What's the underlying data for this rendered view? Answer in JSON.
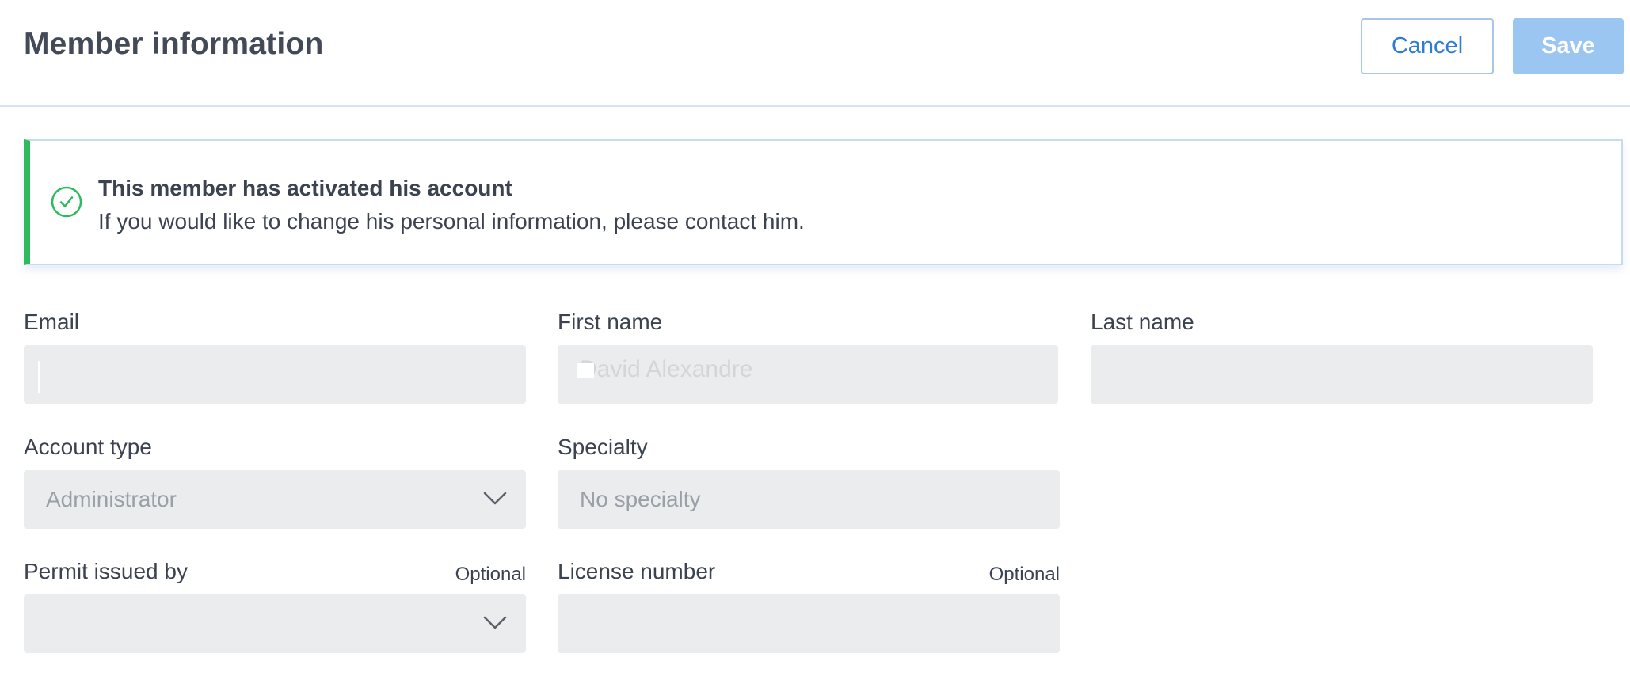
{
  "header": {
    "title": "Member information",
    "cancel_label": "Cancel",
    "save_label": "Save"
  },
  "banner": {
    "icon": "check-circle-icon",
    "title": "This member has activated his account",
    "text": "If you would like to change his personal information, please contact him."
  },
  "form": {
    "email": {
      "label": "Email",
      "value": ""
    },
    "first_name": {
      "label": "First name",
      "value": "David Alexandre"
    },
    "last_name": {
      "label": "Last name",
      "value": ""
    },
    "account_type": {
      "label": "Account type",
      "value": "Administrator"
    },
    "specialty": {
      "label": "Specialty",
      "value": "No specialty"
    },
    "permit_issued_by": {
      "label": "Permit issued by",
      "optional": "Optional",
      "value": ""
    },
    "license_number": {
      "label": "License number",
      "optional": "Optional",
      "value": ""
    }
  },
  "colors": {
    "accent": "#2f7bd6",
    "save_disabled": "#9cc6f2",
    "success": "#2dbb5d",
    "field_bg": "#ebecee"
  }
}
